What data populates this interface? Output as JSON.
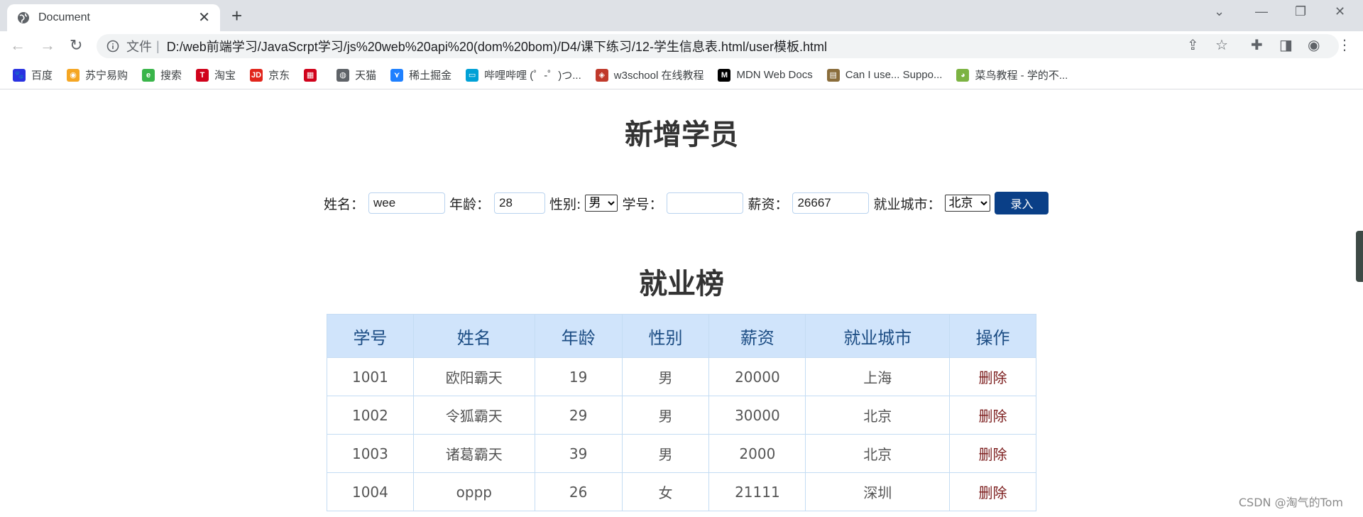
{
  "browser": {
    "tab_title": "Document",
    "file_label": "文件",
    "url": "D:/web前端学习/JavaScrpt学习/js%20web%20api%20(dom%20bom)/D4/课下练习/12-学生信息表.html/user模板.html",
    "bookmarks": [
      {
        "label": "百度",
        "icon": "baidu-icon",
        "color": "#2932e1",
        "glyph": "🐾"
      },
      {
        "label": "苏宁易购",
        "icon": "suning-icon",
        "color": "#f5a623",
        "glyph": "◉"
      },
      {
        "label": "搜索",
        "icon": "search-e-icon",
        "color": "#39b54a",
        "glyph": "e"
      },
      {
        "label": "淘宝",
        "icon": "taobao-icon",
        "color": "#d0021b",
        "glyph": "T"
      },
      {
        "label": "京东",
        "icon": "jd-icon",
        "color": "#e1251b",
        "glyph": "JD"
      },
      {
        "label": "",
        "icon": "grid-icon",
        "color": "#d0021b",
        "glyph": "▦"
      },
      {
        "label": "天猫",
        "icon": "globe-icon",
        "color": "#5f6368",
        "glyph": "◍"
      },
      {
        "label": "稀土掘金",
        "icon": "juejin-icon",
        "color": "#1e80ff",
        "glyph": "⋎"
      },
      {
        "label": "哔哩哔哩 (゜-゜)つ...",
        "icon": "bilibili-icon",
        "color": "#00a1d6",
        "glyph": "▭"
      },
      {
        "label": "w3school 在线教程",
        "icon": "w3school-icon",
        "color": "#c0392b",
        "glyph": "◈"
      },
      {
        "label": "MDN Web Docs",
        "icon": "mdn-icon",
        "color": "#000000",
        "glyph": "M"
      },
      {
        "label": "Can I use... Suppo...",
        "icon": "caniuse-icon",
        "color": "#8a6d3b",
        "glyph": "▤"
      },
      {
        "label": "菜鸟教程 - 学的不...",
        "icon": "runoob-icon",
        "color": "#7cb342",
        "glyph": "◕"
      }
    ]
  },
  "page": {
    "title": "新增学员",
    "form": {
      "name_label": "姓名：",
      "name_value": "wee",
      "age_label": "年龄：",
      "age_value": "28",
      "gender_label": "性别:",
      "gender_value": "男",
      "id_label": "学号：",
      "id_value": "",
      "salary_label": "薪资：",
      "salary_value": "26667",
      "city_label": "就业城市：",
      "city_value": "北京",
      "submit_label": "录入"
    },
    "table_title": "就业榜",
    "columns": [
      "学号",
      "姓名",
      "年龄",
      "性别",
      "薪资",
      "就业城市",
      "操作"
    ],
    "rows": [
      [
        "1001",
        "欧阳霸天",
        "19",
        "男",
        "20000",
        "上海",
        "删除"
      ],
      [
        "1002",
        "令狐霸天",
        "29",
        "男",
        "30000",
        "北京",
        "删除"
      ],
      [
        "1003",
        "诸葛霸天",
        "39",
        "男",
        "2000",
        "北京",
        "删除"
      ],
      [
        "1004",
        "oppp",
        "26",
        "女",
        "21111",
        "深圳",
        "删除"
      ]
    ],
    "watermark": "CSDN @淘气的Tom"
  }
}
